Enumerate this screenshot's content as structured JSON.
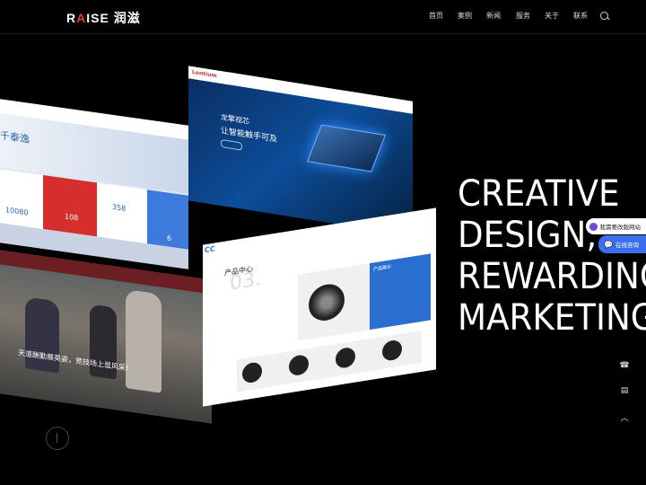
{
  "brand": {
    "latin_r": "R",
    "latin_a": "A",
    "latin_rest": "ISE",
    "cn": "润滋"
  },
  "nav": {
    "items": [
      "首页",
      "案例",
      "新闻",
      "服务",
      "关于",
      "联系"
    ]
  },
  "hero": {
    "lines": [
      "CREATIVE",
      "DESIGN,",
      "REWARDING",
      "MARKETING"
    ]
  },
  "mocks": {
    "tech": {
      "brand": "Lontium",
      "title1": "龙擎视芯",
      "title2": "让智能触手可及"
    },
    "stats": {
      "title": "千泰逸",
      "v1": "10080",
      "v2": "108",
      "v3": "358",
      "v4": "6"
    },
    "school": {
      "caption": "天道酬勤展英姿，竞技场上显风采!"
    },
    "product": {
      "logo": "CC",
      "title": "产品中心",
      "num": "03.",
      "side_title": "产品展示"
    }
  },
  "float": {
    "consult": "我需要改版网站",
    "online": "在线咨询"
  },
  "colors": {
    "accent": "#e23b2a",
    "blue": "#3c6ef0",
    "purple": "#6a4ce0"
  }
}
